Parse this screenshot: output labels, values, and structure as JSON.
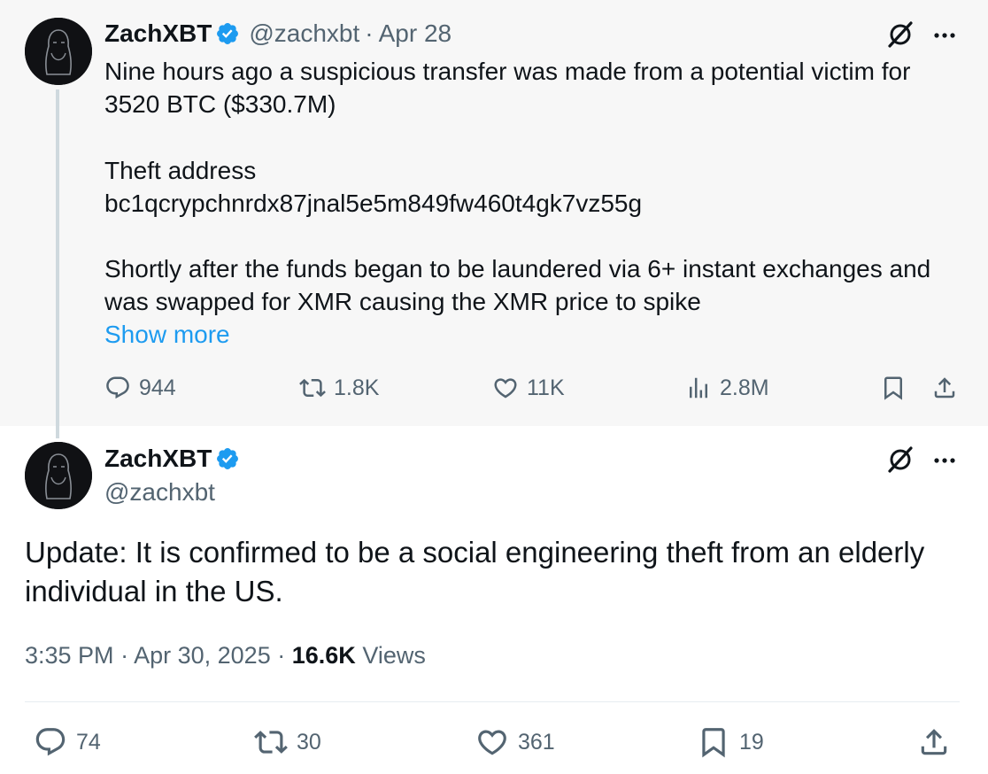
{
  "parent": {
    "name": "ZachXBT",
    "handle": "@zachxbt",
    "separator": "·",
    "date": "Apr 28",
    "text_line1": "Nine hours ago a suspicious transfer was made from a potential victim for",
    "text_line2": "3520 BTC ($330.7M)",
    "text_line3": "Theft address",
    "text_line4": "bc1qcrypchnrdx87jnal5e5m849fw460t4gk7vz55g",
    "text_line5": "Shortly after the funds began to be laundered via 6+ instant exchanges and",
    "text_line6": "was swapped for XMR causing the XMR price to spike",
    "show_more": "Show more",
    "actions": {
      "replies": "944",
      "reposts": "1.8K",
      "likes": "11K",
      "views": "2.8M"
    }
  },
  "main": {
    "name": "ZachXBT",
    "handle": "@zachxbt",
    "text": "Update: It is confirmed to be a social engineering theft from an elderly individual in the US.",
    "time": "3:35 PM",
    "separator": "·",
    "date": "Apr 30, 2025",
    "views_count": "16.6K",
    "views_label": "Views",
    "actions": {
      "replies": "74",
      "reposts": "30",
      "likes": "361",
      "bookmarks": "19"
    }
  },
  "colors": {
    "accent": "#1d9bf0",
    "muted": "#536471",
    "text": "#0f1419",
    "parent_bg": "#f7f7f7"
  },
  "icons": [
    "verified-badge-icon",
    "grok-icon",
    "more-icon",
    "reply-icon",
    "repost-icon",
    "like-icon",
    "views-icon",
    "bookmark-icon",
    "share-icon"
  ]
}
